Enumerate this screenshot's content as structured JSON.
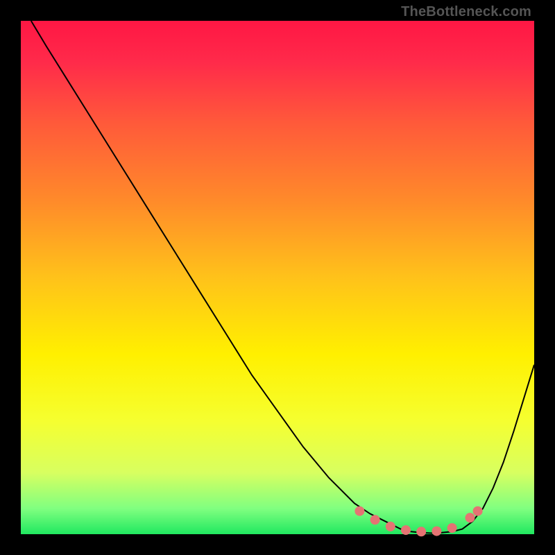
{
  "watermark": "TheBottleneck.com",
  "chart_data": {
    "type": "line",
    "title": "",
    "xlabel": "",
    "ylabel": "",
    "xlim": [
      0,
      100
    ],
    "ylim": [
      0,
      100
    ],
    "grid": false,
    "legend": false,
    "series": [
      {
        "name": "bottleneck-curve",
        "x": [
          2,
          5,
          10,
          15,
          20,
          25,
          30,
          35,
          40,
          45,
          50,
          55,
          60,
          65,
          68,
          70,
          72,
          74,
          76,
          78,
          80,
          82,
          84,
          86,
          88,
          90,
          92,
          94,
          96,
          100
        ],
        "y": [
          100,
          95,
          87,
          79,
          71,
          63,
          55,
          47,
          39,
          31,
          24,
          17,
          11,
          6,
          4,
          3,
          2,
          1,
          0.5,
          0.3,
          0.2,
          0.3,
          0.5,
          1,
          2.5,
          5,
          9,
          14,
          20,
          33
        ],
        "color": "#000000",
        "width": 2
      }
    ],
    "gradient_stops": [
      {
        "offset": 0.0,
        "color": "#ff1744"
      },
      {
        "offset": 0.08,
        "color": "#ff2a4a"
      },
      {
        "offset": 0.2,
        "color": "#ff5a3a"
      },
      {
        "offset": 0.35,
        "color": "#ff8a2a"
      },
      {
        "offset": 0.5,
        "color": "#ffc21a"
      },
      {
        "offset": 0.65,
        "color": "#fff000"
      },
      {
        "offset": 0.78,
        "color": "#f5ff30"
      },
      {
        "offset": 0.88,
        "color": "#d8ff60"
      },
      {
        "offset": 0.95,
        "color": "#80ff80"
      },
      {
        "offset": 1.0,
        "color": "#20e860"
      }
    ],
    "markers": {
      "name": "highlight-dots",
      "color": "#e57373",
      "radius": 7,
      "points": [
        {
          "x": 66,
          "y": 4.5
        },
        {
          "x": 69,
          "y": 2.8
        },
        {
          "x": 72,
          "y": 1.5
        },
        {
          "x": 75,
          "y": 0.8
        },
        {
          "x": 78,
          "y": 0.5
        },
        {
          "x": 81,
          "y": 0.6
        },
        {
          "x": 84,
          "y": 1.2
        },
        {
          "x": 87.5,
          "y": 3.2
        },
        {
          "x": 89,
          "y": 4.5
        }
      ]
    }
  }
}
